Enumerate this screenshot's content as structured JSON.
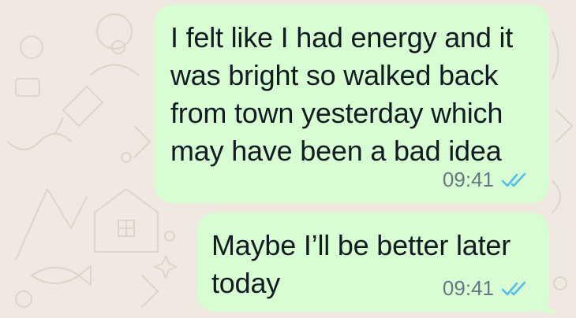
{
  "chat": {
    "messages": [
      {
        "text": "I felt like I had energy and it was bright so walked back from town yesterday which may have been a bad idea",
        "time": "09:41",
        "status_icon": "double-check-read-icon",
        "direction": "outgoing"
      },
      {
        "text": "Maybe I’ll be better later today",
        "time": "09:41",
        "status_icon": "double-check-read-icon",
        "direction": "outgoing"
      }
    ]
  },
  "colors": {
    "wallpaper": "#efe9e1",
    "bubble_outgoing": "#d9fdd3",
    "text": "#111b21",
    "meta_text": "#667781",
    "read_ticks": "#53bdeb"
  }
}
